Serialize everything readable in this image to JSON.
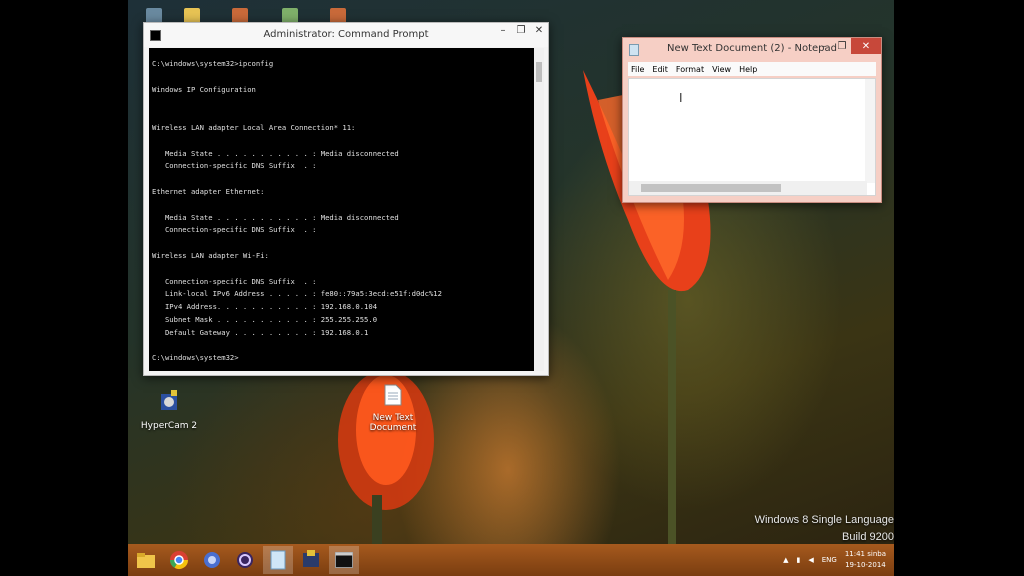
{
  "cmd": {
    "title": "Administrator: Command Prompt",
    "lines": [
      "C:\\windows\\system32>ipconfig",
      "",
      "Windows IP Configuration",
      "",
      "",
      "Wireless LAN adapter Local Area Connection* 11:",
      "",
      "   Media State . . . . . . . . . . . : Media disconnected",
      "   Connection-specific DNS Suffix  . :",
      "",
      "Ethernet adapter Ethernet:",
      "",
      "   Media State . . . . . . . . . . . : Media disconnected",
      "   Connection-specific DNS Suffix  . :",
      "",
      "Wireless LAN adapter Wi-Fi:",
      "",
      "   Connection-specific DNS Suffix  . :",
      "   Link-local IPv6 Address . . . . . : fe80::79a5:3ecd:e51f:d0dc%12",
      "   IPv4 Address. . . . . . . . . . . : 192.168.0.104",
      "   Subnet Mask . . . . . . . . . . . : 255.255.255.0",
      "   Default Gateway . . . . . . . . . : 192.168.0.1",
      "",
      "C:\\windows\\system32>"
    ]
  },
  "notepad": {
    "title": "New Text Document (2) - Notepad",
    "menu": [
      "File",
      "Edit",
      "Format",
      "View",
      "Help"
    ]
  },
  "desktop": {
    "icons": [
      {
        "label": "HyperCam 2",
        "icon": "hypercam-icon"
      },
      {
        "label": "New Text Document",
        "icon": "text-file-icon"
      }
    ]
  },
  "taskbar": {
    "items": [
      "file-explorer-icon",
      "chrome-icon",
      "app-icon",
      "app-icon",
      "notepad-icon",
      "app-icon",
      "command-prompt-icon"
    ],
    "lang": "ENG",
    "time": "11:41 sinba",
    "date": "19-10-2014"
  },
  "watermark": {
    "line1": "Windows 8 Single Language",
    "line2": "Build 9200"
  }
}
